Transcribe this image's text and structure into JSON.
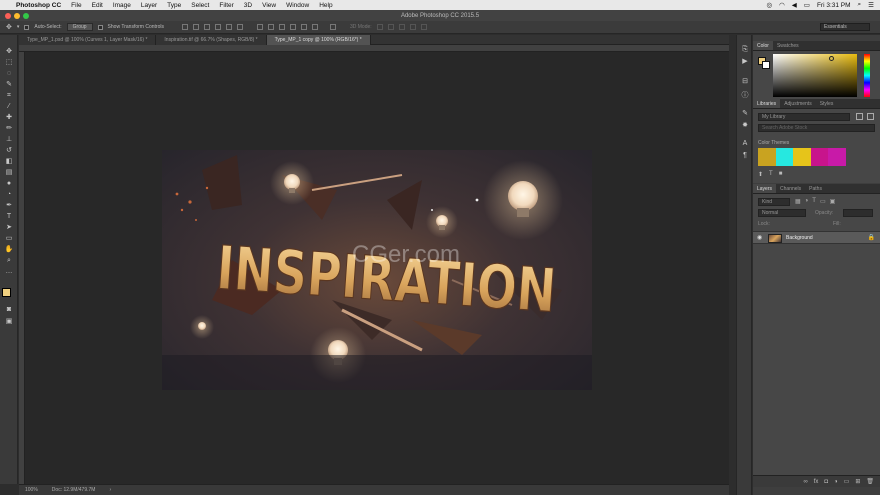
{
  "menubar": {
    "app_name": "Photoshop CC",
    "items": [
      "File",
      "Edit",
      "Image",
      "Layer",
      "Type",
      "Select",
      "Filter",
      "3D",
      "View",
      "Window",
      "Help"
    ],
    "clock": "Fri 3:31 PM"
  },
  "window": {
    "title": "Adobe Photoshop CC 2015.5"
  },
  "options": {
    "auto_select": "Auto-Select:",
    "group": "Group",
    "show_transform": "Show Transform Controls",
    "mode_3d": "3D Mode:",
    "workspace": "Essentials"
  },
  "tabs": [
    "Type_MP_1.psd @ 100% (Curves 1, Layer Mask/16) *",
    "Inspiration.tif @ 66.7% (Shapes, RGB/8) *",
    "Type_MP_1 copy @ 100% (RGB/16*) *"
  ],
  "art": {
    "headline": "INSPIRATION",
    "watermark": "CGer.com"
  },
  "status": {
    "zoom": "100%",
    "doc": "Doc: 12.9M/479.7M"
  },
  "color_panel": {
    "tabs": [
      "Color",
      "Swatches"
    ],
    "fg": "#f0d080"
  },
  "libraries_panel": {
    "tabs": [
      "Libraries",
      "Adjustments",
      "Styles"
    ],
    "library": "My Library",
    "search": "Search Adobe Stock",
    "section": "Color Themes",
    "theme_colors": [
      "#c9a320",
      "#26e8e0",
      "#e6c41a",
      "#c8148c",
      "#c81aa8"
    ]
  },
  "layers_panel": {
    "tabs": [
      "Layers",
      "Channels",
      "Paths"
    ],
    "kind": "Kind",
    "blend": "Normal",
    "opacity": "Opacity:",
    "fill": "Fill:",
    "lock": "Lock:",
    "layer_name": "Background"
  }
}
